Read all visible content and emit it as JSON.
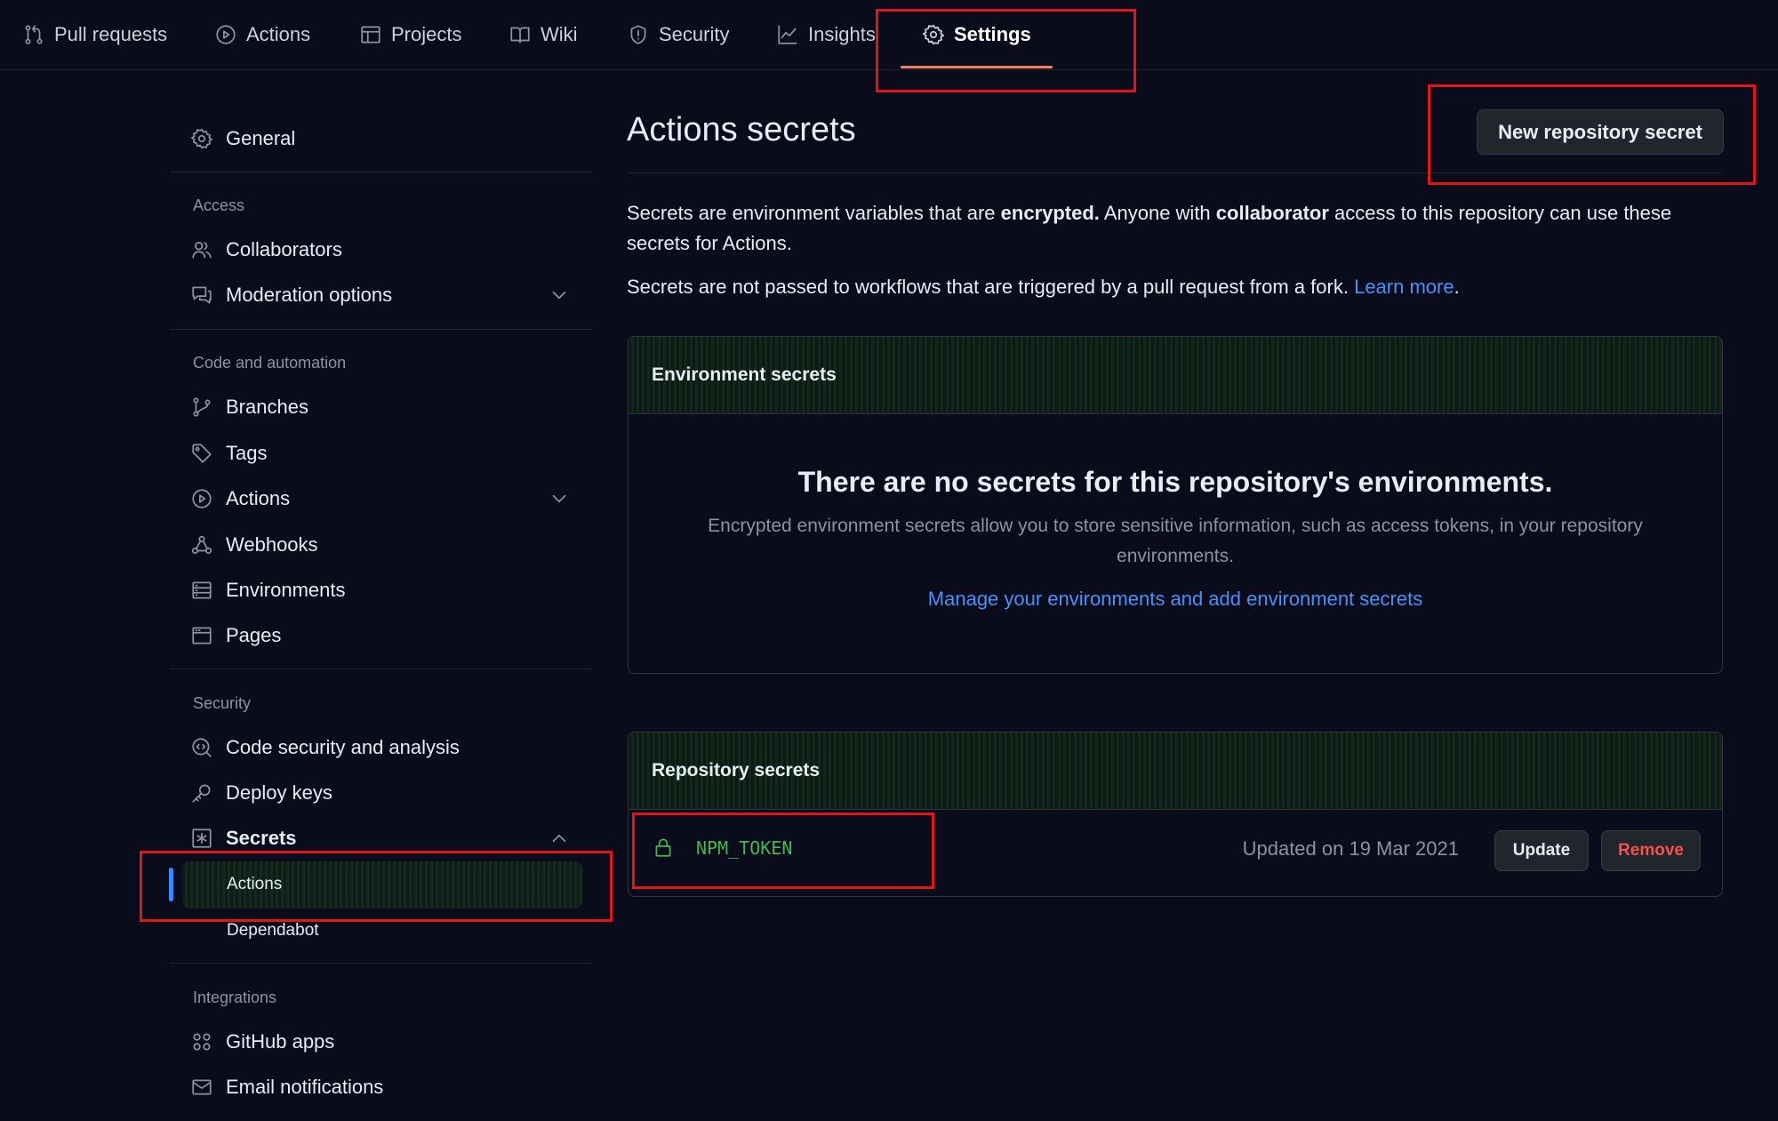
{
  "nav": {
    "tabs": [
      {
        "label": "Pull requests",
        "icon": "pull-request-icon"
      },
      {
        "label": "Actions",
        "icon": "play-icon"
      },
      {
        "label": "Projects",
        "icon": "table-icon"
      },
      {
        "label": "Wiki",
        "icon": "book-icon"
      },
      {
        "label": "Security",
        "icon": "shield-icon"
      },
      {
        "label": "Insights",
        "icon": "graph-icon"
      },
      {
        "label": "Settings",
        "icon": "gear-icon",
        "active": true
      }
    ]
  },
  "sidebar": {
    "general": "General",
    "sections": {
      "access": "Access",
      "code_automation": "Code and automation",
      "security": "Security",
      "integrations": "Integrations"
    },
    "items": {
      "collaborators": "Collaborators",
      "moderation": "Moderation options",
      "branches": "Branches",
      "tags": "Tags",
      "actions": "Actions",
      "webhooks": "Webhooks",
      "environments": "Environments",
      "pages": "Pages",
      "code_security": "Code security and analysis",
      "deploy_keys": "Deploy keys",
      "secrets": "Secrets",
      "secrets_actions": "Actions",
      "secrets_dependabot": "Dependabot",
      "github_apps": "GitHub apps",
      "email_notifications": "Email notifications"
    }
  },
  "main": {
    "title": "Actions secrets",
    "new_secret_button": "New repository secret",
    "desc1_part1": "Secrets are environment variables that are ",
    "desc1_bold1": "encrypted.",
    "desc1_part2": " Anyone with ",
    "desc1_bold2": "collaborator",
    "desc1_part3": " access to this repository can use these secrets for Actions.",
    "desc2": "Secrets are not passed to workflows that are triggered by a pull request from a fork.",
    "learn_more": "Learn more",
    "desc2_end": ".",
    "environment_secrets": {
      "header": "Environment secrets",
      "empty_title": "There are no secrets for this repository's environments.",
      "empty_desc": "Encrypted environment secrets allow you to store sensitive information, such as access tokens, in your repository environments.",
      "manage_link": "Manage your environments and add environment secrets"
    },
    "repository_secrets": {
      "header": "Repository secrets",
      "secrets": [
        {
          "name": "NPM_TOKEN",
          "updated": "Updated on 19 Mar 2021",
          "update_label": "Update",
          "remove_label": "Remove"
        }
      ]
    }
  },
  "colors": {
    "background": "#0a0c1c",
    "accent_link": "#4493f8",
    "success_green": "#3fb950",
    "danger_red": "#f85149",
    "highlight_red": "#e3151a",
    "active_underline": "#f78166"
  }
}
